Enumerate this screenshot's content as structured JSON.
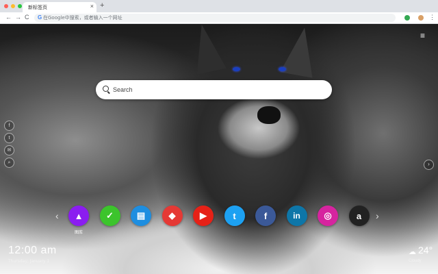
{
  "browser": {
    "tab_title": "新标签页",
    "tab_close": "×",
    "new_tab": "+",
    "back": "←",
    "forward": "→",
    "reload": "C",
    "omnibox_g": "G",
    "omnibox_placeholder": "在Google中搜索，或者输入一个网址",
    "menu_icon": "⋮"
  },
  "page": {
    "menu_icon": "≡",
    "search_placeholder": "Search",
    "social": [
      "f",
      "t",
      "✉",
      "⌕"
    ],
    "right_arrow": "›",
    "prev": "‹",
    "next": "›",
    "shortcuts": [
      {
        "glyph": "▲",
        "bg": "#8b1df0",
        "label": "图库"
      },
      {
        "glyph": "✓",
        "bg": "#3cc42c",
        "label": ""
      },
      {
        "glyph": "▤",
        "bg": "#1e8ee0",
        "label": ""
      },
      {
        "glyph": "◆",
        "bg": "#e53935",
        "label": ""
      },
      {
        "glyph": "▶",
        "bg": "#e62117",
        "label": ""
      },
      {
        "glyph": "t",
        "bg": "#1da1f2",
        "label": ""
      },
      {
        "glyph": "f",
        "bg": "#3b5998",
        "label": ""
      },
      {
        "glyph": "in",
        "bg": "#0e76a8",
        "label": ""
      },
      {
        "glyph": "◎",
        "bg": "#d6249f",
        "label": ""
      },
      {
        "glyph": "a",
        "bg": "#222222",
        "label": ""
      }
    ],
    "clock": "12:00 am",
    "clock_sub": "Thursday, January 1",
    "weather_icon": "☁",
    "temperature": "24°",
    "weather_sub": "Cloudy"
  }
}
